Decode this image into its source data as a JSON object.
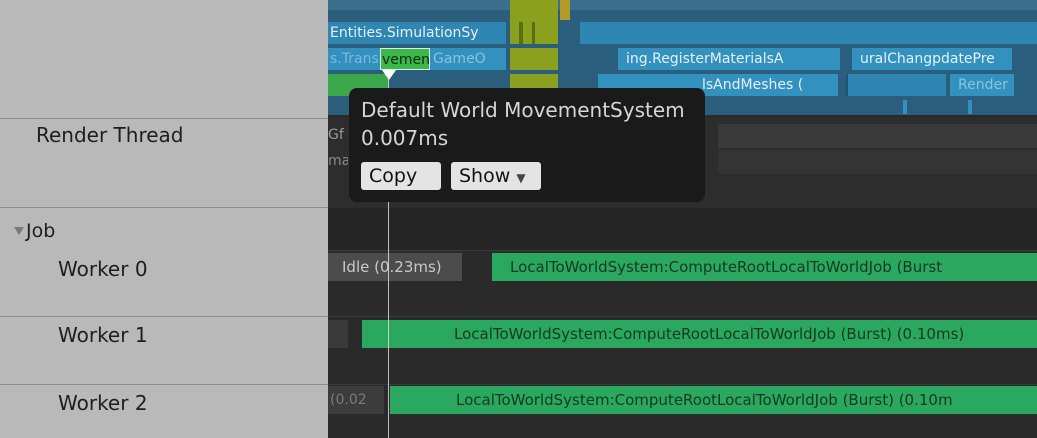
{
  "sidebar": {
    "render_thread": "Render Thread",
    "job": "Job",
    "worker0": "Worker 0",
    "worker1": "Worker 1",
    "worker2": "Worker 2"
  },
  "timeline": {
    "row1": "Entities.SimulationSy",
    "row2_left": "s.Trans",
    "row2_sel": "vemen",
    "row2_mid": "GameO",
    "row2_reg": "ing.RegisterMaterialsA",
    "row2_ural": "uralChangpdatePre",
    "row3_meshes": "lsAndMeshes (",
    "row3_render": "Render",
    "render_gf": "Gf",
    "render_ma": "ma",
    "worker0_idle": "Idle (0.23ms)",
    "worker0_job": "LocalToWorldSystem:ComputeRootLocalToWorldJob (Burst",
    "worker1_job": "LocalToWorldSystem:ComputeRootLocalToWorldJob (Burst) (0.10ms)",
    "worker2_idle": "(0.02",
    "worker2_job": "LocalToWorldSystem:ComputeRootLocalToWorldJob (Burst) (0.10m"
  },
  "tooltip": {
    "title": "Default World MovementSystem",
    "time": "0.007ms",
    "copy_label": "Copy",
    "show_label": "Show"
  },
  "colors": {
    "sidebar_bg": "#b9b9b9",
    "timeline_bg": "#2a2a2a",
    "blue_block": "#2f86b3",
    "green_job": "#2aa860",
    "olive": "#8aa01e",
    "tooltip_bg": "#1a1a1a"
  }
}
